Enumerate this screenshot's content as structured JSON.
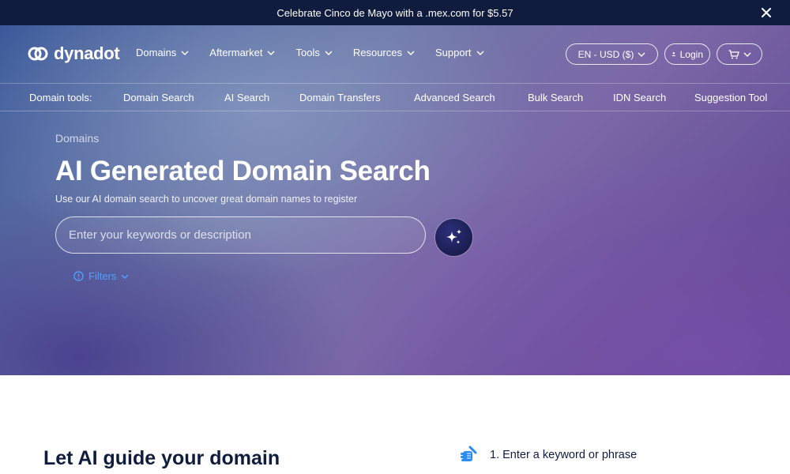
{
  "promo": {
    "text": "Celebrate Cinco de Mayo with a .mex.com for $5.57"
  },
  "brand": {
    "name": "dynadot"
  },
  "nav": {
    "items": [
      {
        "label": "Domains"
      },
      {
        "label": "Aftermarket"
      },
      {
        "label": "Tools"
      },
      {
        "label": "Resources"
      },
      {
        "label": "Support"
      }
    ],
    "language": "EN - USD ($)",
    "login": "Login"
  },
  "tools": {
    "label": "Domain tools:",
    "links": [
      "Domain Search",
      "AI Search",
      "Domain Transfers",
      "Advanced Search",
      "Bulk Search",
      "IDN Search",
      "Suggestion Tool"
    ]
  },
  "hero": {
    "breadcrumb": "Domains",
    "title": "AI Generated Domain Search",
    "subtitle": "Use our AI domain search to uncover great domain names to register",
    "search_placeholder": "Enter your keywords or description",
    "filters_label": "Filters"
  },
  "section": {
    "heading": "Let AI guide your domain",
    "step1": "1. Enter a keyword or phrase"
  },
  "colors": {
    "promo_bg": "#0f1c3d",
    "accent_link": "#4ea2ff",
    "heading_dark": "#0f1c3d"
  }
}
